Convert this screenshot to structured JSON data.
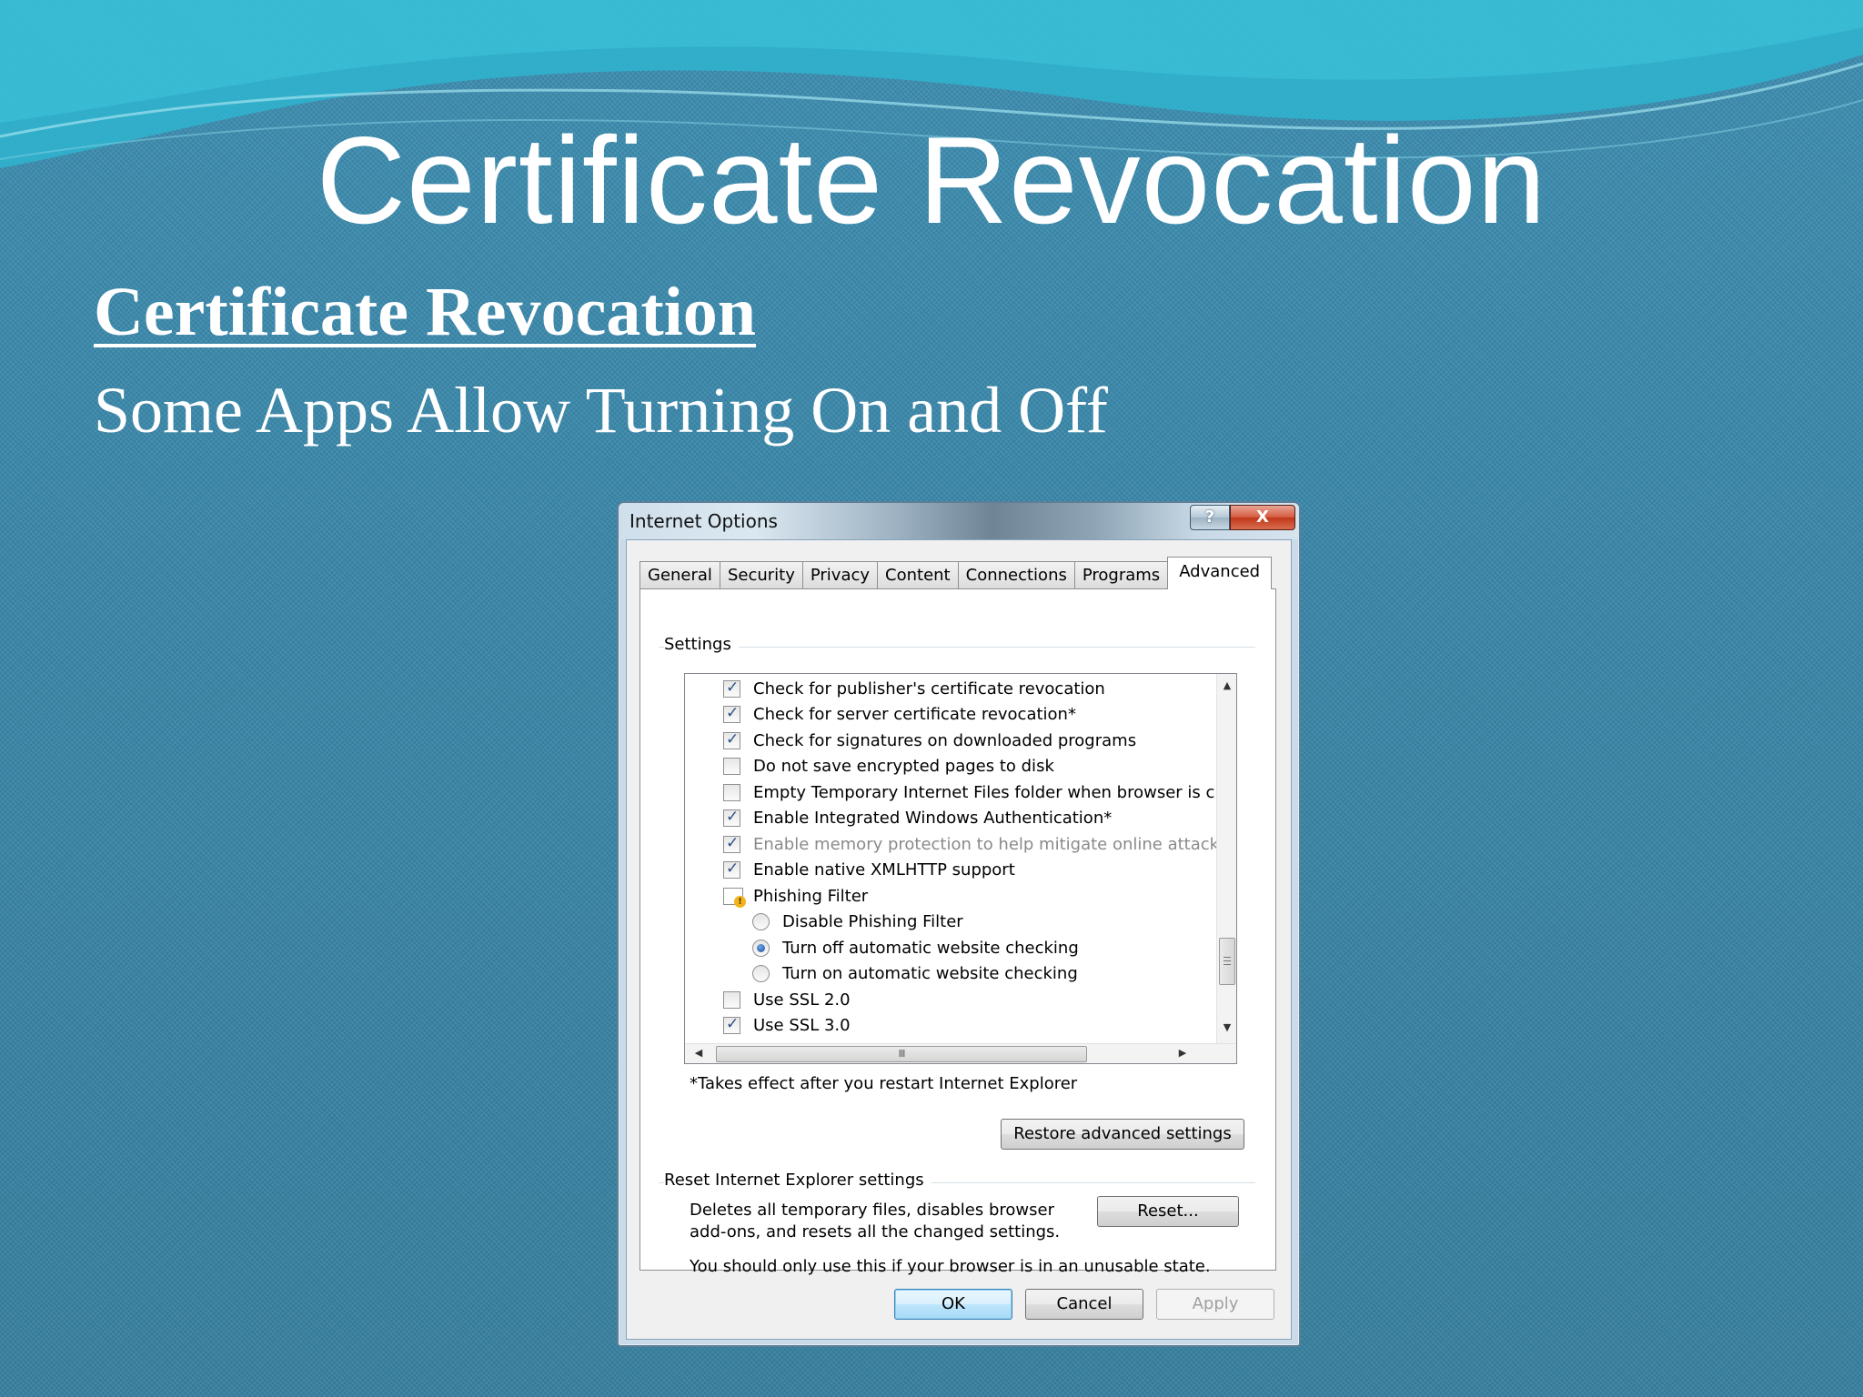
{
  "slide": {
    "title": "Certificate Revocation",
    "heading": "Certificate Revocation",
    "subtitle": "Some Apps Allow Turning On and Off"
  },
  "dialog": {
    "title": "Internet Options",
    "help_button": "?",
    "close_button": "X",
    "tabs": [
      {
        "label": "General"
      },
      {
        "label": "Security"
      },
      {
        "label": "Privacy"
      },
      {
        "label": "Content"
      },
      {
        "label": "Connections"
      },
      {
        "label": "Programs"
      },
      {
        "label": "Advanced",
        "active": true
      }
    ],
    "settings_label": "Settings",
    "settings_items": [
      {
        "type": "checkbox",
        "checked": true,
        "label": "Check for publisher's certificate revocation"
      },
      {
        "type": "checkbox",
        "checked": true,
        "label": "Check for server certificate revocation*"
      },
      {
        "type": "checkbox",
        "checked": true,
        "label": "Check for signatures on downloaded programs"
      },
      {
        "type": "checkbox",
        "checked": false,
        "label": "Do not save encrypted pages to disk"
      },
      {
        "type": "checkbox",
        "checked": false,
        "label": "Empty Temporary Internet Files folder when browser is clo"
      },
      {
        "type": "checkbox",
        "checked": true,
        "label": "Enable Integrated Windows Authentication*"
      },
      {
        "type": "checkbox",
        "checked": true,
        "disabled": true,
        "label": "Enable memory protection to help mitigate online attacks"
      },
      {
        "type": "checkbox",
        "checked": true,
        "label": "Enable native XMLHTTP support"
      },
      {
        "type": "group",
        "label": "Phishing Filter"
      },
      {
        "type": "radio",
        "checked": false,
        "label": "Disable Phishing Filter"
      },
      {
        "type": "radio",
        "checked": true,
        "label": "Turn off automatic website checking"
      },
      {
        "type": "radio",
        "checked": false,
        "label": "Turn on automatic website checking"
      },
      {
        "type": "checkbox",
        "checked": false,
        "label": "Use SSL 2.0"
      },
      {
        "type": "checkbox",
        "checked": true,
        "label": "Use SSL 3.0"
      }
    ],
    "scroll_thumb_grip": "III",
    "restart_note": "*Takes effect after you restart Internet Explorer",
    "restore_button": "Restore advanced settings",
    "reset_group_label": "Reset Internet Explorer settings",
    "reset_description_line1": "Deletes all temporary files, disables browser",
    "reset_description_line2": "add-ons, and resets all the changed settings.",
    "reset_button": "Reset...",
    "reset_warning": "You should only use this if your browser is in an unusable state.",
    "ok_button": "OK",
    "cancel_button": "Cancel",
    "apply_button": "Apply"
  }
}
